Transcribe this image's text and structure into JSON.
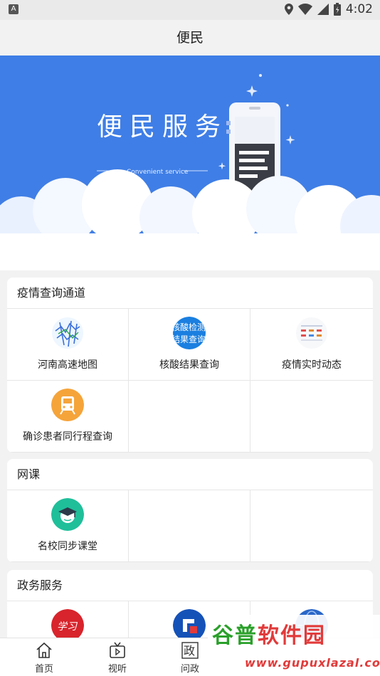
{
  "status_bar": {
    "app_badge": "A",
    "time": "4:02"
  },
  "header": {
    "title": "便民"
  },
  "banner": {
    "title": "便民服务",
    "subtitle": "Convenient service",
    "background_color": "#3f7ee6"
  },
  "sections": [
    {
      "title": "疫情查询通道",
      "items": [
        {
          "label": "河南高速地图",
          "icon": "highway-map-icon"
        },
        {
          "label": "核酸结果查询",
          "icon": "nucleic-test-icon",
          "icon_text_1": "核酸检测",
          "icon_text_2": "结果查询"
        },
        {
          "label": "疫情实时动态",
          "icon": "epidemic-dashboard-icon"
        },
        {
          "label": "确诊患者同行程查询",
          "icon": "train-icon"
        }
      ]
    },
    {
      "title": "网课",
      "items": [
        {
          "label": "名校同步课堂",
          "icon": "graduation-cap-icon"
        }
      ]
    },
    {
      "title": "政务服务",
      "items": [
        {
          "label": "",
          "icon": "red-logo-icon",
          "icon_text": "学习"
        },
        {
          "label": "",
          "icon": "blue-logo-icon"
        },
        {
          "label": "",
          "icon": "blue-globe-icon"
        }
      ]
    }
  ],
  "tabbar": {
    "items": [
      {
        "label": "首页",
        "icon": "home-icon"
      },
      {
        "label": "视听",
        "icon": "tv-icon"
      },
      {
        "label": "问政",
        "icon": "zheng-icon",
        "icon_text": "政"
      }
    ]
  },
  "watermark": {
    "text_1": "谷普",
    "text_2": "软件园",
    "url": "www.gupuxlazal.com"
  }
}
